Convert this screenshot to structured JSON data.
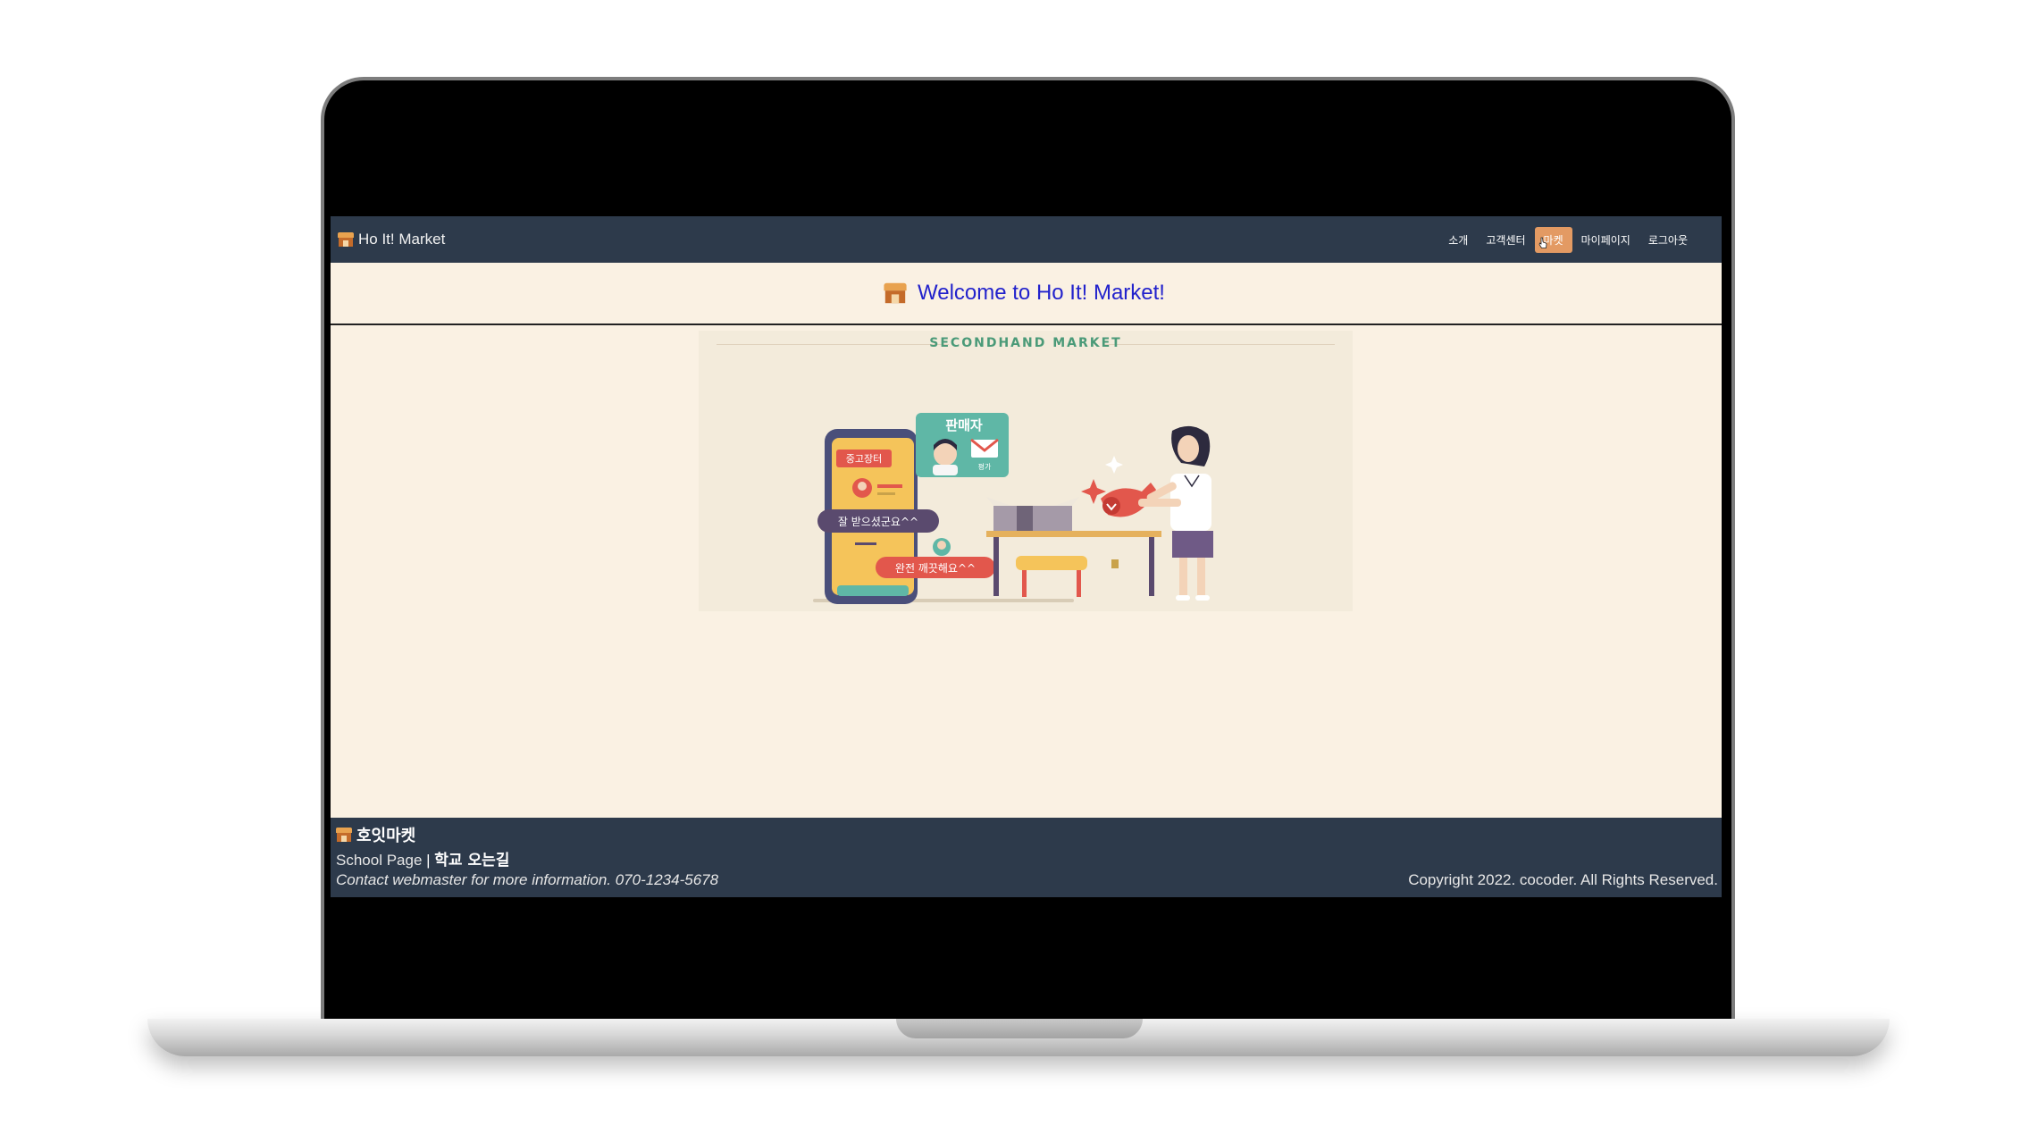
{
  "navbar": {
    "brand": "Ho It! Market",
    "links": [
      "소개",
      "고객센터",
      "마켓",
      "마이페이지",
      "로그아웃"
    ]
  },
  "welcome": {
    "title": "Welcome to Ho It! Market!"
  },
  "banner": {
    "heading": "SECONDHAND MARKET",
    "illustration": {
      "seller_label": "판매자",
      "market_tag": "중고장터",
      "rating_label": "평가",
      "bubble_received": "잘 받으셨군요^^",
      "bubble_clean": "완전 깨끗해요^^"
    }
  },
  "footer": {
    "brand": "호잇마켓",
    "school_page": "School Page",
    "separator": "|",
    "directions": "학교 오는길",
    "contact": "Contact webmaster for more information. 070-1234-5678",
    "copyright": "Copyright 2022. cocoder. All Rights Reserved."
  },
  "colors": {
    "navbar_bg": "#2d3a4b",
    "page_bg": "#faf1e3",
    "active_nav": "#e39a63",
    "welcome_text": "#2222cc",
    "banner_heading": "#4a9a78"
  }
}
